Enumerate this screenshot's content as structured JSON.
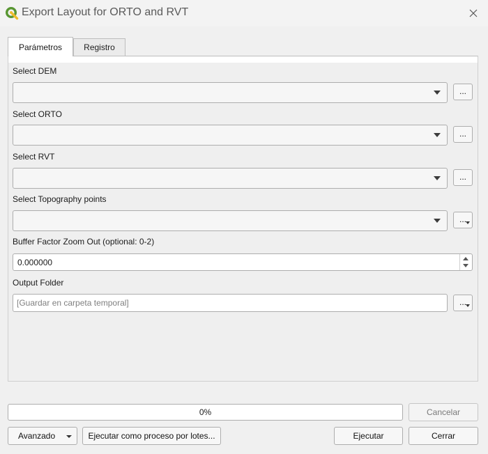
{
  "window": {
    "title": "Export Layout for ORTO and RVT",
    "app_icon": "qgis-logo-icon",
    "close_icon": "close-icon"
  },
  "tabs": [
    {
      "label": "Parámetros",
      "active": true
    },
    {
      "label": "Registro",
      "active": false
    }
  ],
  "params": {
    "dem": {
      "label": "Select DEM",
      "value": "",
      "browse_label": "..."
    },
    "orto": {
      "label": "Select ORTO",
      "value": "",
      "browse_label": "..."
    },
    "rvt": {
      "label": "Select RVT",
      "value": "",
      "browse_label": "..."
    },
    "topo": {
      "label": "Select Topography points",
      "value": "",
      "browse_label": "..."
    },
    "buffer": {
      "label": "Buffer Factor Zoom Out (optional: 0-2)",
      "value": "0.000000"
    },
    "output": {
      "label": "Output Folder",
      "placeholder": "[Guardar en carpeta temporal]",
      "browse_label": "..."
    }
  },
  "footer": {
    "progress_text": "0%",
    "progress_value": 0,
    "cancel_label": "Cancelar",
    "advanced_label": "Avanzado",
    "batch_label": "Ejecutar como proceso por lotes...",
    "run_label": "Ejecutar",
    "close_label": "Cerrar"
  },
  "colors": {
    "qgis_green": "#589632",
    "qgis_yellow": "#eebc2c"
  }
}
